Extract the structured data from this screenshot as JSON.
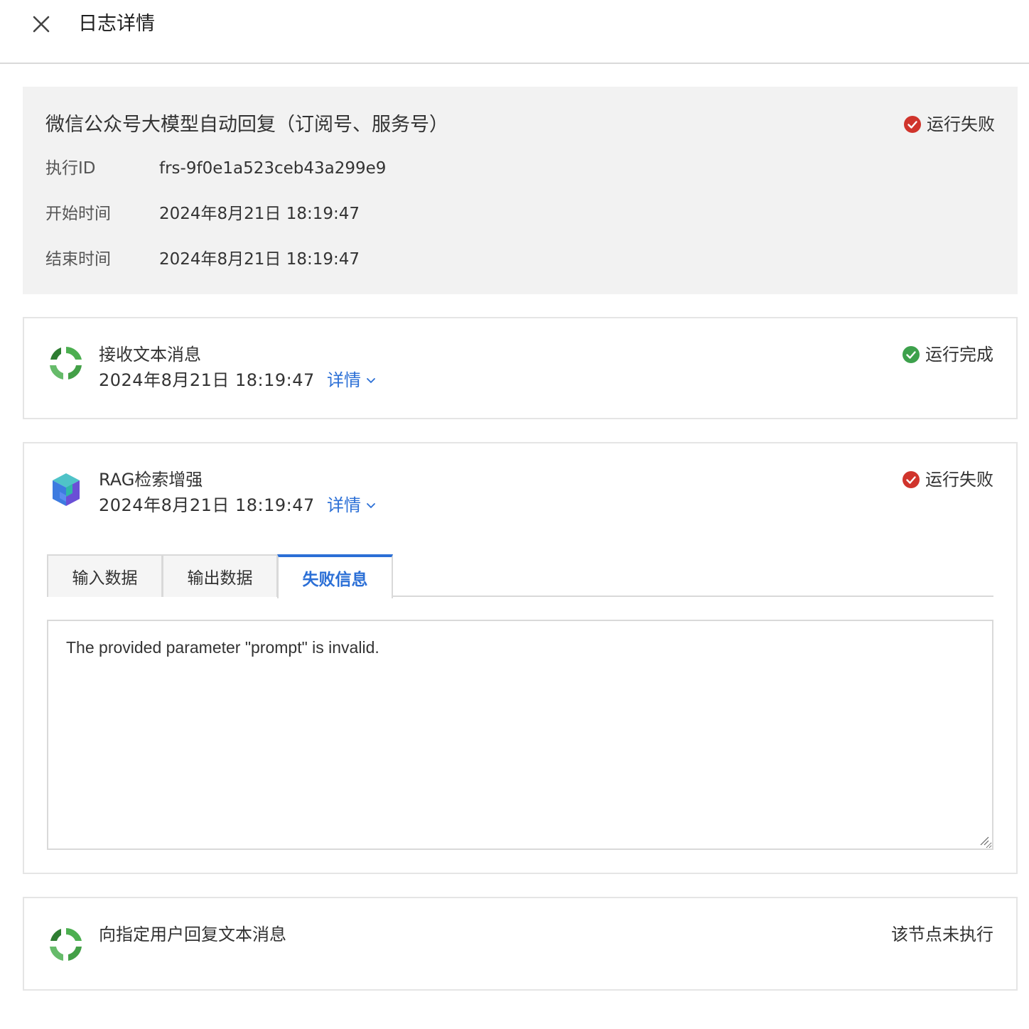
{
  "header": {
    "title": "日志详情",
    "close_icon": "close-icon"
  },
  "summary": {
    "title": "微信公众号大模型自动回复（订阅号、服务号）",
    "status": "运行失败",
    "status_color": "#d0342c",
    "fields": [
      {
        "label": "执行ID",
        "value": "frs-9f0e1a523ceb43a299e9"
      },
      {
        "label": "开始时间",
        "value": "2024年8月21日 18:19:47"
      },
      {
        "label": "结束时间",
        "value": "2024年8月21日 18:19:47"
      }
    ]
  },
  "nodes": [
    {
      "name": "接收文本消息",
      "time": "2024年8月21日 18:19:47",
      "details": "详情",
      "status": "运行完成",
      "status_color": "#3da14c",
      "icon": "wechat-flow-icon"
    },
    {
      "name": "RAG检索增强",
      "time": "2024年8月21日 18:19:47",
      "details": "详情",
      "status": "运行失败",
      "status_color": "#d0342c",
      "icon": "rag-cube-icon",
      "tabs": [
        "输入数据",
        "输出数据",
        "失败信息"
      ],
      "active_tab": "失败信息",
      "error_text": "The provided parameter \"prompt\" is invalid."
    },
    {
      "name": "向指定用户回复文本消息",
      "status": "该节点未执行",
      "icon": "wechat-flow-icon"
    }
  ],
  "colors": {
    "accent": "#2b6fd6",
    "summary_bg": "#f2f2f2",
    "border": "#d9d9d9"
  }
}
